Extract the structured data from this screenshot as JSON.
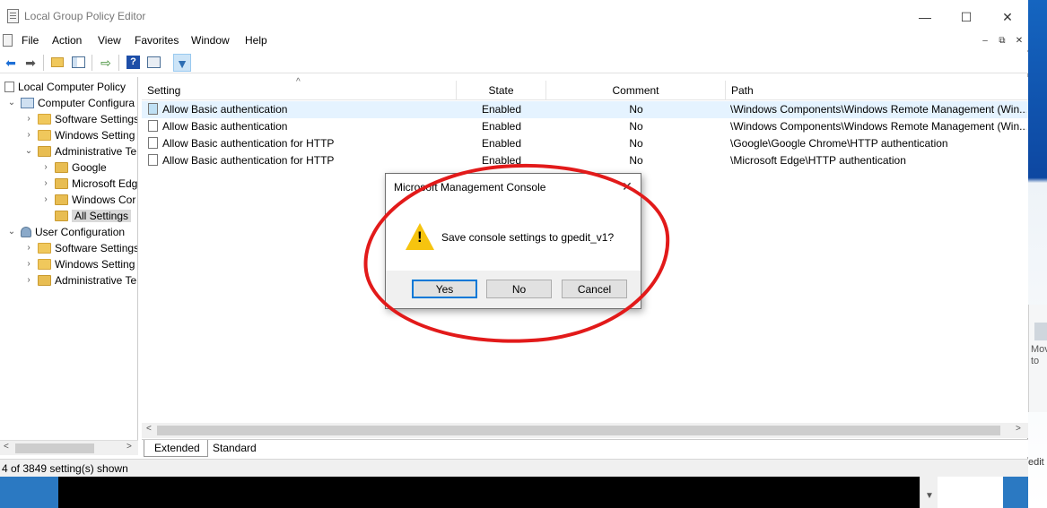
{
  "window": {
    "title": "Local Group Policy Editor",
    "controls": {
      "minimize": "—",
      "maximize": "☐",
      "close": "✕"
    }
  },
  "menu": {
    "items": [
      "File",
      "Action",
      "View",
      "Favorites",
      "Window",
      "Help"
    ],
    "mdi": {
      "minimize": "–",
      "restore": "⧉",
      "close": "✕"
    }
  },
  "toolbar": {
    "icons": [
      "back-arrow-icon",
      "forward-arrow-icon",
      "up-folder-icon",
      "show-hide-tree-icon",
      "export-list-icon",
      "help-icon",
      "properties-icon",
      "filter-icon"
    ]
  },
  "tree": {
    "items": [
      {
        "label": "Local Computer Policy",
        "icon": "doc-icon"
      },
      {
        "label": "Computer Configura",
        "icon": "computer-icon"
      },
      {
        "label": "Software Settings",
        "icon": "folder-icon"
      },
      {
        "label": "Windows Setting",
        "icon": "folder-icon"
      },
      {
        "label": "Administrative Te",
        "icon": "folder-settings-icon"
      },
      {
        "label": "Google",
        "icon": "folder-settings-icon"
      },
      {
        "label": "Microsoft Edg",
        "icon": "folder-settings-icon"
      },
      {
        "label": "Windows Cor",
        "icon": "folder-settings-icon"
      },
      {
        "label": "All Settings",
        "icon": "all-settings-icon"
      },
      {
        "label": "User Configuration",
        "icon": "user-icon"
      },
      {
        "label": "Software Settings",
        "icon": "folder-icon"
      },
      {
        "label": "Windows Setting",
        "icon": "folder-icon"
      },
      {
        "label": "Administrative Te",
        "icon": "folder-settings-icon"
      }
    ]
  },
  "list": {
    "columns": [
      "Setting",
      "State",
      "Comment",
      "Path"
    ],
    "rows": [
      {
        "setting": "Allow Basic authentication",
        "state": "Enabled",
        "comment": "No",
        "path": "\\Windows Components\\Windows Remote Management (Win..."
      },
      {
        "setting": "Allow Basic authentication",
        "state": "Enabled",
        "comment": "No",
        "path": "\\Windows Components\\Windows Remote Management (Win..."
      },
      {
        "setting": "Allow Basic authentication for HTTP",
        "state": "Enabled",
        "comment": "No",
        "path": "\\Google\\Google Chrome\\HTTP authentication"
      },
      {
        "setting": "Allow Basic authentication for HTTP",
        "state": "Enabled",
        "comment": "No",
        "path": "\\Microsoft Edge\\HTTP authentication"
      }
    ]
  },
  "tabs": [
    "Extended",
    "Standard"
  ],
  "status": "4 of 3849 setting(s) shown",
  "dialog": {
    "title": "Microsoft Management Console",
    "message": "Save console settings to gpedit_v1?",
    "buttons": {
      "yes": "Yes",
      "no": "No",
      "cancel": "Cancel"
    }
  },
  "background": {
    "peek_text_1": "Mov",
    "peek_text_2": "to",
    "edge_text": "edit"
  },
  "colors": {
    "accent": "#0078d7",
    "annotation": "#e21a1a",
    "warning": "#f6c40f",
    "row_highlight": "#e5f3ff"
  }
}
